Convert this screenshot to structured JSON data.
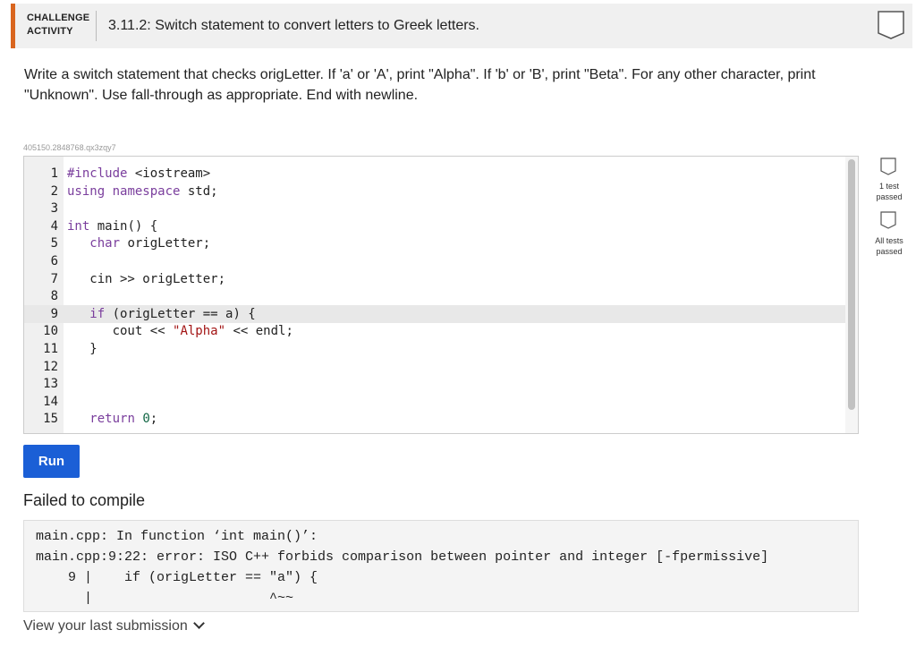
{
  "header": {
    "badge_line1": "CHALLENGE",
    "badge_line2": "ACTIVITY",
    "title": "3.11.2: Switch statement to convert letters to Greek letters."
  },
  "instructions": "Write a switch statement that checks origLetter. If 'a' or 'A', print \"Alpha\". If 'b' or 'B', print \"Beta\". For any other character, print \"Unknown\". Use fall-through as appropriate. End with newline.",
  "code_id": "405150.2848768.qx3zqy7",
  "editor": {
    "lines": [
      {
        "num": "1",
        "code": "#include <iostream>"
      },
      {
        "num": "2",
        "code": "using namespace std;"
      },
      {
        "num": "3",
        "code": ""
      },
      {
        "num": "4",
        "code": "int main() {"
      },
      {
        "num": "5",
        "code": "   char origLetter;"
      },
      {
        "num": "6",
        "code": ""
      },
      {
        "num": "7",
        "code": "   cin >> origLetter;"
      },
      {
        "num": "8",
        "code": ""
      },
      {
        "num": "9",
        "code": "   if (origLetter == a) {"
      },
      {
        "num": "10",
        "code": "      cout << \"Alpha\" << endl;"
      },
      {
        "num": "11",
        "code": "   }"
      },
      {
        "num": "12",
        "code": ""
      },
      {
        "num": "13",
        "code": ""
      },
      {
        "num": "14",
        "code": ""
      },
      {
        "num": "15",
        "code": "   return 0;"
      }
    ]
  },
  "tests": {
    "one_test_line1": "1 test",
    "one_test_line2": "passed",
    "all_tests_line1": "All tests",
    "all_tests_line2": "passed"
  },
  "run_label": "Run",
  "result_title": "Failed to compile",
  "console_text": "main.cpp: In function ‘int main()’:\nmain.cpp:9:22: error: ISO C++ forbids comparison between pointer and integer [-fpermissive]\n    9 |    if (origLetter == \"a\") {\n      |                      ^~~",
  "last_submission_label": "View your last submission"
}
